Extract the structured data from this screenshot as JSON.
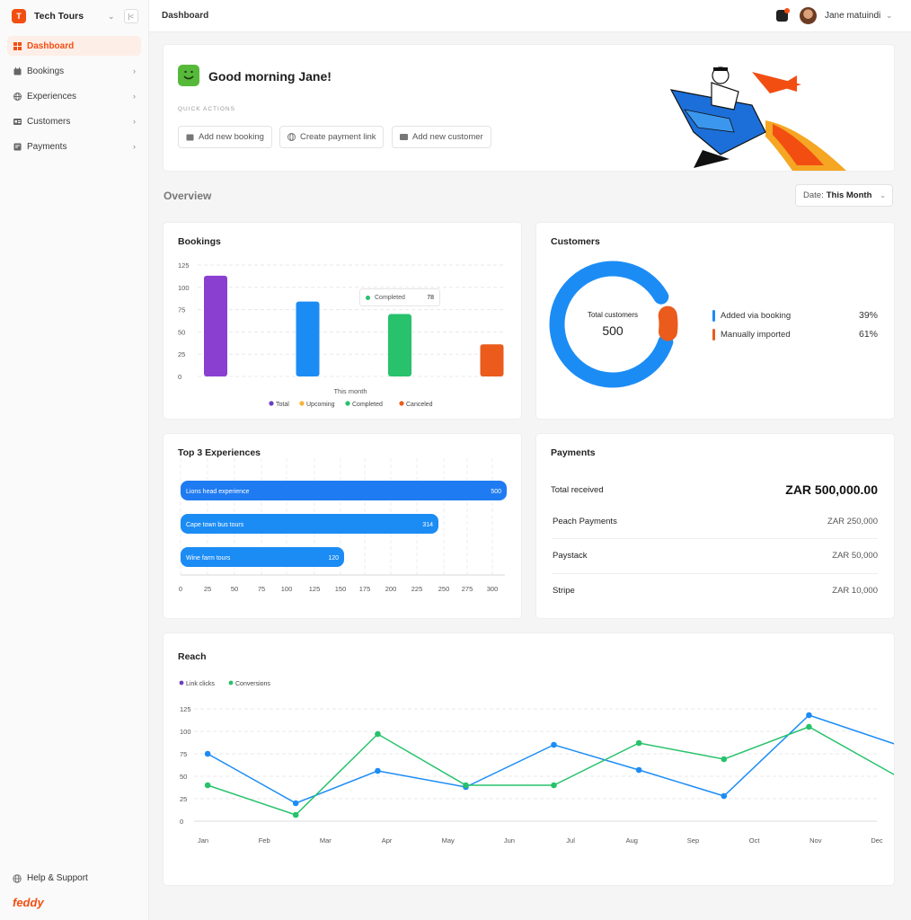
{
  "brand": {
    "initial": "T",
    "name": "Tech Tours"
  },
  "sidebar": {
    "items": [
      {
        "label": "Dashboard",
        "icon": "grid-icon",
        "active": true
      },
      {
        "label": "Bookings",
        "icon": "calendar-icon"
      },
      {
        "label": "Experiences",
        "icon": "globe-icon"
      },
      {
        "label": "Customers",
        "icon": "id-card-icon"
      },
      {
        "label": "Payments",
        "icon": "receipt-icon"
      }
    ],
    "help": "Help & Support",
    "footer_logo": "feddy"
  },
  "topbar": {
    "title": "Dashboard",
    "user_name": "Jane matuindi"
  },
  "greeting": {
    "text": "Good morning Jane!",
    "quick_actions_label": "QUICK ACTIONS",
    "actions": [
      "Add new booking",
      "Create payment link",
      "Add new customer"
    ]
  },
  "overview": {
    "title": "Overview",
    "date_label": "Date:",
    "date_value": "This Month"
  },
  "colors": {
    "accent": "#f24e12",
    "purple": "#8a3fd0",
    "blue": "#1c8cf5",
    "green": "#27c26b",
    "orange": "#ea5b1c",
    "amber": "#f5b334"
  },
  "bookings": {
    "title": "Bookings",
    "tooltip": {
      "label": "Completed",
      "value": "78"
    }
  },
  "customers": {
    "title": "Customers",
    "center_label": "Total customers",
    "center_value": "500",
    "legend": [
      {
        "label": "Added via booking",
        "value": "39%"
      },
      {
        "label": "Manually imported",
        "value": "61%"
      }
    ]
  },
  "experiences": {
    "title": "Top 3 Experiences"
  },
  "payments": {
    "title": "Payments",
    "total_label": "Total received",
    "total_value": "ZAR 500,000.00",
    "rows": [
      {
        "name": "Peach Payments",
        "value": "ZAR 250,000"
      },
      {
        "name": "Paystack",
        "value": "ZAR 50,000"
      },
      {
        "name": "Stripe",
        "value": "ZAR 10,000"
      }
    ]
  },
  "reach": {
    "title": "Reach"
  },
  "chart_data": [
    {
      "type": "bar",
      "title": "Bookings",
      "xlabel": "This month",
      "categories": [
        "Total",
        "Upcoming",
        "Completed",
        "Canceled"
      ],
      "values": [
        113,
        84,
        70,
        36
      ],
      "colors": [
        "#8a3fd0",
        "#1c8cf5",
        "#27c26b",
        "#ea5b1c"
      ],
      "legend": [
        "Total",
        "Upcoming",
        "Completed",
        "Canceled"
      ],
      "legend_colors": [
        "#6a3fc2",
        "#f5b334",
        "#27c26b",
        "#ea5b1c"
      ],
      "yticks": [
        0,
        25,
        50,
        75,
        100,
        125
      ],
      "ylim": [
        0,
        125
      ],
      "grid": true
    },
    {
      "type": "pie",
      "title": "Customers",
      "series": [
        {
          "name": "Manually imported",
          "value": 61,
          "color": "#1c8cf5"
        },
        {
          "name": "Added via booking",
          "value": 39,
          "color": "#ea5b1c"
        }
      ]
    },
    {
      "type": "bar",
      "orientation": "horizontal",
      "title": "Top 3 Experiences",
      "categories": [
        "Lions head experience",
        "Cape town bus tours",
        "Wine farm tours"
      ],
      "values": [
        500,
        314,
        120
      ],
      "colors": [
        "#1f7bf2",
        "#1c8cf5",
        "#1c8cf5"
      ],
      "xticks": [
        0,
        25,
        50,
        75,
        100,
        125,
        150,
        175,
        200,
        225,
        250,
        275,
        300
      ],
      "grid": true
    },
    {
      "type": "line",
      "title": "Reach",
      "categories": [
        "Jan",
        "Feb",
        "Mar",
        "Apr",
        "May",
        "Jun",
        "Jul",
        "Aug",
        "Sep",
        "Oct",
        "Nov",
        "Dec"
      ],
      "points_x": [
        0.15,
        1.6,
        2.95,
        4.4,
        5.85,
        7.25,
        8.65,
        10.05,
        11.5
      ],
      "series": [
        {
          "name": "Link clicks",
          "color": "#1c8cf5",
          "legend_color": "#6a3fc2",
          "values": [
            75,
            20,
            56,
            38,
            85,
            57,
            28,
            118,
            85
          ]
        },
        {
          "name": "Conversions",
          "color": "#27c26b",
          "legend_color": "#27c26b",
          "values": [
            40,
            7,
            97,
            40,
            40,
            87,
            69,
            105,
            50
          ]
        }
      ],
      "yticks": [
        0,
        25,
        50,
        75,
        100,
        125
      ],
      "ylim": [
        0,
        125
      ],
      "grid": true
    }
  ]
}
